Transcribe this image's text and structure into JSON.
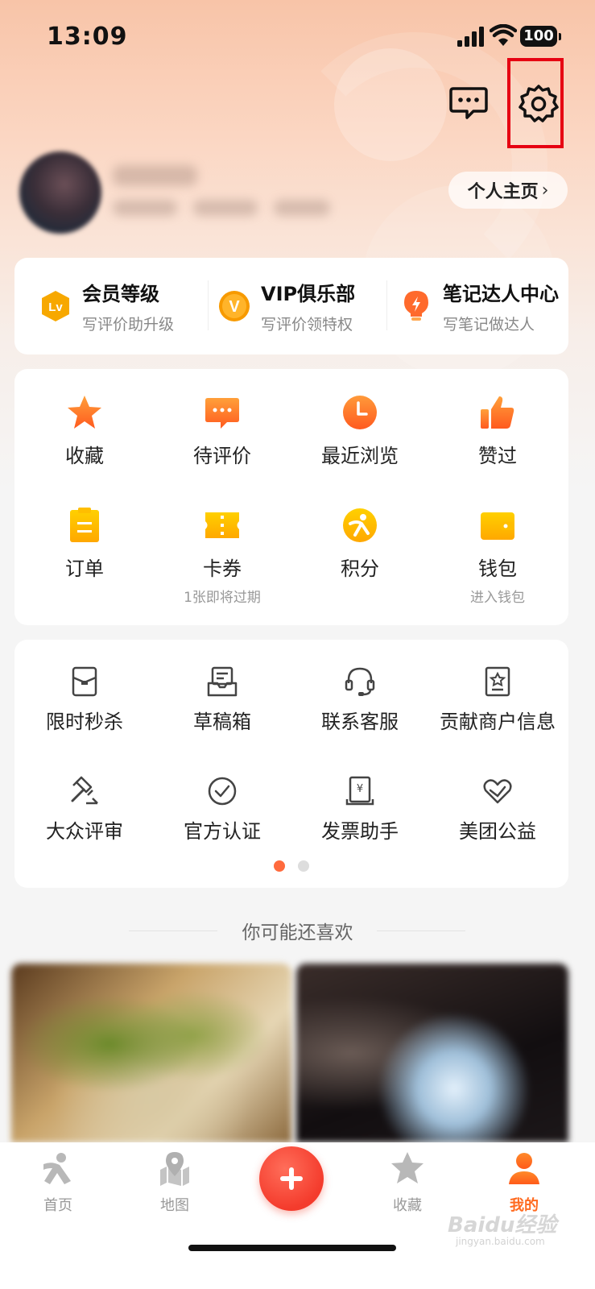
{
  "status_bar": {
    "time": "13:09",
    "battery": "100"
  },
  "header": {
    "profile_button_label": "个人主页",
    "icons": [
      "message-icon",
      "settings-icon"
    ]
  },
  "member": [
    {
      "title": "会员等级",
      "subtitle": "写评价助升级",
      "icon": "lv-badge-icon",
      "color": "#f7a800"
    },
    {
      "title": "VIP俱乐部",
      "subtitle": "写评价领特权",
      "icon": "vip-badge-icon",
      "color": "#f79a00"
    },
    {
      "title": "笔记达人中心",
      "subtitle": "写笔记做达人",
      "icon": "bulb-icon",
      "color": "#ff6a2c"
    }
  ],
  "grid1": [
    {
      "label": "收藏",
      "sub": "",
      "icon": "star-icon"
    },
    {
      "label": "待评价",
      "sub": "",
      "icon": "comment-icon"
    },
    {
      "label": "最近浏览",
      "sub": "",
      "icon": "clock-icon"
    },
    {
      "label": "赞过",
      "sub": "",
      "icon": "thumbs-up-icon"
    },
    {
      "label": "订单",
      "sub": "",
      "icon": "order-icon"
    },
    {
      "label": "卡券",
      "sub": "1张即将过期",
      "icon": "coupon-icon"
    },
    {
      "label": "积分",
      "sub": "",
      "icon": "points-icon"
    },
    {
      "label": "钱包",
      "sub": "进入钱包",
      "icon": "wallet-icon"
    }
  ],
  "grid2": [
    {
      "label": "限时秒杀",
      "icon": "flash-sale-icon"
    },
    {
      "label": "草稿箱",
      "icon": "drafts-icon"
    },
    {
      "label": "联系客服",
      "icon": "headset-icon"
    },
    {
      "label": "贡献商户信息",
      "icon": "merchant-info-icon"
    },
    {
      "label": "大众评审",
      "icon": "gavel-icon"
    },
    {
      "label": "官方认证",
      "icon": "check-circle-icon"
    },
    {
      "label": "发票助手",
      "icon": "invoice-icon"
    },
    {
      "label": "美团公益",
      "icon": "charity-heart-icon"
    }
  ],
  "pager": {
    "pages": 2,
    "active": 1
  },
  "recommend": {
    "title": "你可能还喜欢"
  },
  "tab_bar": [
    {
      "label": "首页",
      "icon": "home-person-icon",
      "active": false
    },
    {
      "label": "地图",
      "icon": "map-pin-icon",
      "active": false
    },
    {
      "label": "",
      "icon": "plus-icon",
      "active": false
    },
    {
      "label": "收藏",
      "icon": "star-tab-icon",
      "active": false
    },
    {
      "label": "我的",
      "icon": "profile-icon",
      "active": true
    }
  ],
  "watermark": {
    "text": "Baidu经验",
    "sub": "jingyan.baidu.com"
  },
  "colors": {
    "accent": "#ff6a1f",
    "highlight_box": "#e60012"
  }
}
